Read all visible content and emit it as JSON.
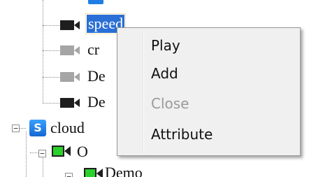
{
  "tree": {
    "nodes": [
      {
        "label": "speed",
        "icon": "camera-dark-icon",
        "selected": true
      },
      {
        "label": "cr",
        "icon": "camera-gray-icon"
      },
      {
        "label": "De",
        "icon": "camera-gray-icon"
      },
      {
        "label": "De",
        "icon": "camera-dark-icon"
      },
      {
        "label": "cloud",
        "icon": "server-s-icon",
        "badge": "S",
        "expander": "−"
      },
      {
        "label": "O",
        "icon": "camera-green-icon",
        "expander": "−"
      },
      {
        "label": "Demo",
        "icon": "camera-green-icon",
        "expander": "−"
      }
    ]
  },
  "context_menu": {
    "items": [
      {
        "label": "Play",
        "enabled": true
      },
      {
        "label": "Add",
        "enabled": true
      },
      {
        "label": "Close",
        "enabled": false
      },
      {
        "label": "Attribute",
        "enabled": true
      }
    ]
  },
  "colors": {
    "selection": "#2a6fd6",
    "camera_dark": "#1e1e1e",
    "camera_gray": "#a5a5a5",
    "camera_green": "#2bd12b",
    "server_blue": "#1f7fe6",
    "menu_bg": "#f0f0f0",
    "disabled_text": "#9a9a9a"
  }
}
